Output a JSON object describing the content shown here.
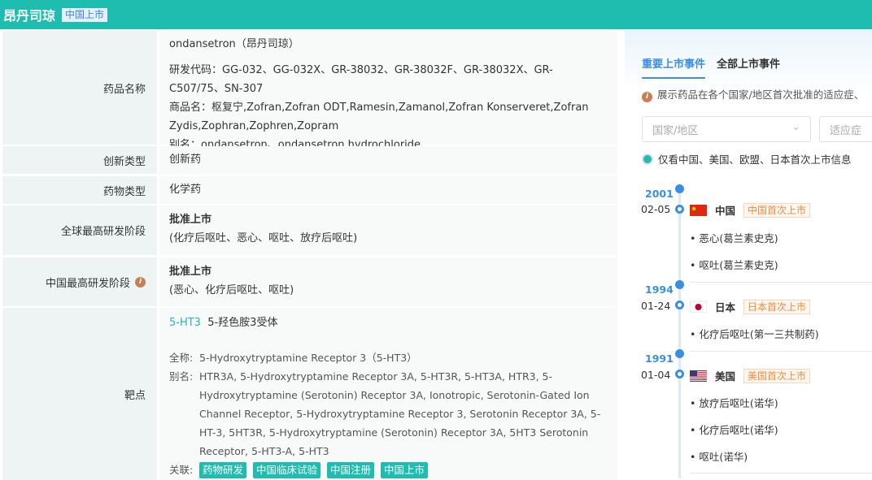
{
  "header": {
    "title": "昂丹司琼",
    "badge": "中国上市"
  },
  "rows": {
    "name": {
      "label": "药品名称",
      "en": "ondansetron（昂丹司琼）",
      "codes": "研发代码：GG-032、GG-032X、GR-38032、GR-38032F、GR-38032X、GR-C507/75、SN-307",
      "trade": "商品名：枢复宁,Zofran,Zofran ODT,Ramesin,Zamanol,Zofran Konserveret,Zofran Zydis,Zophran,Zophren,Zopram",
      "alias": "别名：ondansetron、ondansetron hydrochloride"
    },
    "innovation": {
      "label": "创新类型",
      "value": "创新药"
    },
    "type": {
      "label": "药物类型",
      "value": "化学药"
    },
    "global": {
      "label": "全球最高研发阶段",
      "stage": "批准上市",
      "detail": "(化疗后呕吐、恶心、呕吐、放疗后呕吐)"
    },
    "china": {
      "label": "中国最高研发阶段",
      "stage": "批准上市",
      "detail": "(恶心、化疗后呕吐、呕吐)"
    },
    "target": {
      "label": "靶点",
      "name": "5-HT3",
      "desc": "5-羟色胺3受体",
      "full_k": "全称:",
      "full": "5-Hydroxytryptamine Receptor 3（5-HT3）",
      "alias_k": "别名:",
      "alias": "HTR3A, 5-Hydroxytryptamine Receptor 3A, 5-HT3R, 5-HT3A, HTR3, 5-Hydroxytryptamine (Serotonin) Receptor 3A, Ionotropic, Serotonin-Gated Ion Channel Receptor, 5-Hydroxytryptamine Receptor 3, Serotonin Receptor 3A, 5-HT-3, 5HT3R, 5-Hydroxytryptamine (Serotonin) Receptor 3A, 5HT3 Serotonin Receptor, 5-HT3-A, 5-HT3",
      "rel_k": "关联:",
      "chips": [
        "药物研发",
        "中国临床试验",
        "中国注册",
        "中国上市"
      ]
    }
  },
  "panel": {
    "tabs": [
      "重要上市事件",
      "全部上市事件"
    ],
    "note": "展示药品在各个国家/地区首次批准的适应症、",
    "country_placeholder": "国家/地区",
    "indication_placeholder": "适应症",
    "radio": "仅看中国、美国、欧盟、日本首次上市信息",
    "events": [
      {
        "year": "2001",
        "date": "02-05",
        "country": "中国",
        "tag": "中国首次上市",
        "items": [
          "恶心(葛兰素史克)",
          "呕吐(葛兰素史克)"
        ]
      },
      {
        "year": "1994",
        "date": "01-24",
        "country": "日本",
        "tag": "日本首次上市",
        "items": [
          "化疗后呕吐(第一三共制药)"
        ]
      },
      {
        "year": "1991",
        "date": "01-04",
        "country": "美国",
        "tag": "美国首次上市",
        "items": [
          "放疗后呕吐(诺华)",
          "化疗后呕吐(诺华)",
          "呕吐(诺华)"
        ]
      }
    ]
  }
}
